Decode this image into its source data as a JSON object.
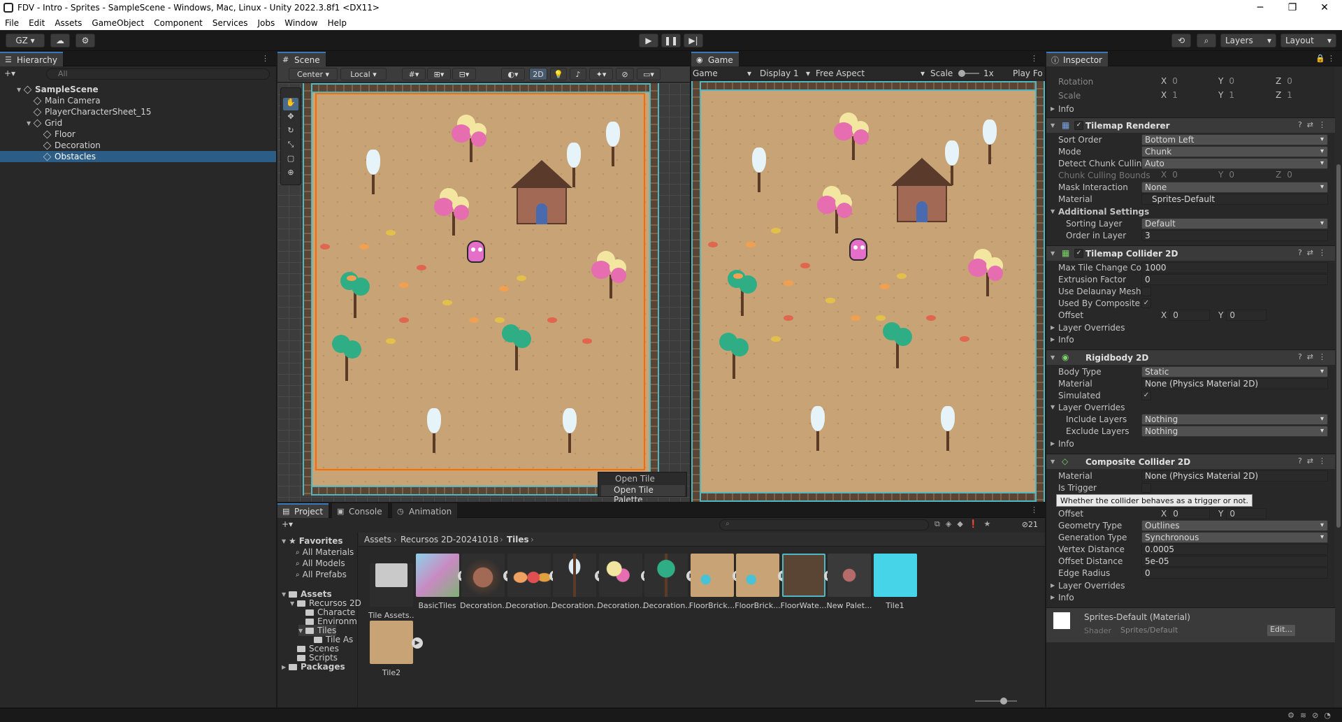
{
  "window": {
    "title": "FDV - Intro - Sprites - SampleScene - Windows, Mac, Linux - Unity 2022.3.8f1 <DX11>",
    "minimize": "─",
    "maximize": "❐",
    "close": "✕"
  },
  "menu": [
    "File",
    "Edit",
    "Assets",
    "GameObject",
    "Component",
    "Services",
    "Jobs",
    "Window",
    "Help"
  ],
  "toolbar": {
    "account": "GZ",
    "layers": "Layers",
    "layout": "Layout"
  },
  "hierarchy": {
    "tab": "Hierarchy",
    "search_placeholder": "All",
    "items": [
      {
        "label": "SampleScene",
        "depth": 0,
        "selected": false
      },
      {
        "label": "Main Camera",
        "depth": 1,
        "selected": false
      },
      {
        "label": "PlayerCharacterSheet_15",
        "depth": 1,
        "selected": false
      },
      {
        "label": "Grid",
        "depth": 1,
        "selected": false
      },
      {
        "label": "Floor",
        "depth": 2,
        "selected": false
      },
      {
        "label": "Decoration",
        "depth": 2,
        "selected": false
      },
      {
        "label": "Obstacles",
        "depth": 2,
        "selected": true
      }
    ]
  },
  "scene": {
    "tab": "Scene",
    "pivot": "Center",
    "space": "Local",
    "mode2d": "2D",
    "palette_button": "Open Tile Palette",
    "palette_tooltip": "Open Tile Palette"
  },
  "game": {
    "tab": "Game",
    "view": "Game",
    "display": "Display 1",
    "aspect": "Free Aspect",
    "scale_label": "Scale",
    "scale_value": "1x",
    "play_focus": "Play Fo"
  },
  "inspector": {
    "tab": "Inspector",
    "transform": {
      "rotation_label": "Rotation",
      "scale_label": "Scale",
      "rot": [
        "0",
        "0",
        "0"
      ],
      "scale": [
        "1",
        "1",
        "1"
      ],
      "info": "Info"
    },
    "tilemap_renderer": {
      "title": "Tilemap Renderer",
      "sort_order_label": "Sort Order",
      "sort_order": "Bottom Left",
      "mode_label": "Mode",
      "mode": "Chunk",
      "detect_label": "Detect Chunk Culling Bou",
      "detect": "Auto",
      "bounds_label": "Chunk Culling Bounds",
      "bounds": [
        "0",
        "0",
        "0"
      ],
      "mask_label": "Mask Interaction",
      "mask": "None",
      "material_label": "Material",
      "material": "Sprites-Default",
      "additional": "Additional Settings",
      "sorting_layer_label": "Sorting Layer",
      "sorting_layer": "Default",
      "order_label": "Order in Layer",
      "order": "3"
    },
    "tilemap_collider": {
      "title": "Tilemap Collider 2D",
      "max_label": "Max Tile Change Count",
      "max": "1000",
      "extrusion_label": "Extrusion Factor",
      "extrusion": "0",
      "delaunay_label": "Use Delaunay Mesh",
      "composite_label": "Used By Composite",
      "offset_label": "Offset",
      "offset": [
        "0",
        "0"
      ],
      "overrides": "Layer Overrides",
      "info": "Info"
    },
    "rigidbody": {
      "title": "Rigidbody 2D",
      "body_label": "Body Type",
      "body": "Static",
      "material_label": "Material",
      "material": "None (Physics Material 2D)",
      "simulated_label": "Simulated",
      "overrides": "Layer Overrides",
      "include_label": "Include Layers",
      "include": "Nothing",
      "exclude_label": "Exclude Layers",
      "exclude": "Nothing",
      "info": "Info"
    },
    "composite": {
      "title": "Composite Collider 2D",
      "material_label": "Material",
      "material": "None (Physics Material 2D)",
      "trigger_label": "Is Trigger",
      "tooltip": "Whether the collider behaves as a trigger or not.",
      "offset_label": "Offset",
      "offset": [
        "0",
        "0"
      ],
      "geometry_label": "Geometry Type",
      "geometry": "Outlines",
      "generation_label": "Generation Type",
      "generation": "Synchronous",
      "vertex_label": "Vertex Distance",
      "vertex": "0.0005",
      "offsetd_label": "Offset Distance",
      "offsetd": "5e-05",
      "edge_label": "Edge Radius",
      "edge": "0",
      "overrides": "Layer Overrides",
      "info": "Info"
    },
    "material_footer": {
      "title": "Sprites-Default (Material)",
      "shader_label": "Shader",
      "shader": "Sprites/Default",
      "edit": "Edit..."
    }
  },
  "project": {
    "tabs": [
      "Project",
      "Console",
      "Animation"
    ],
    "count": "21",
    "breadcrumb": [
      "Assets",
      "Recursos 2D-20241018",
      "Tiles"
    ],
    "favorites": {
      "label": "Favorites",
      "items": [
        "All Materials",
        "All Models",
        "All Prefabs"
      ]
    },
    "tree": [
      {
        "label": "Assets",
        "depth": 0
      },
      {
        "label": "Recursos 2D",
        "depth": 1
      },
      {
        "label": "Characte",
        "depth": 2
      },
      {
        "label": "Environm",
        "depth": 2
      },
      {
        "label": "Tiles",
        "depth": 2
      },
      {
        "label": "Tile As",
        "depth": 3
      },
      {
        "label": "Scenes",
        "depth": 1
      },
      {
        "label": "Scripts",
        "depth": 1
      },
      {
        "label": "Packages",
        "depth": 0
      }
    ],
    "assets": [
      {
        "name": "Tile Assets...",
        "kind": "folder"
      },
      {
        "name": "BasicTiles",
        "kind": "tiles"
      },
      {
        "name": "Decoration...",
        "kind": "house"
      },
      {
        "name": "Decoration...",
        "kind": "candy"
      },
      {
        "name": "Decoration...",
        "kind": "snowtree"
      },
      {
        "name": "Decoration...",
        "kind": "icecream"
      },
      {
        "name": "Decoration...",
        "kind": "greentree"
      },
      {
        "name": "FloorBrick...",
        "kind": "floor"
      },
      {
        "name": "FloorBrick...",
        "kind": "floor"
      },
      {
        "name": "FloorWate...",
        "kind": "water"
      },
      {
        "name": "New Palet...",
        "kind": "palette"
      },
      {
        "name": "Tile1",
        "kind": "cyan"
      },
      {
        "name": "Tile2",
        "kind": "sand"
      }
    ]
  },
  "colors": {
    "accent": "#3a79bb",
    "selection": "#2c5d87",
    "panel": "#282828",
    "sand": "#c7a376",
    "fence": "#5a4433",
    "water_edge": "#4fb8c2"
  }
}
